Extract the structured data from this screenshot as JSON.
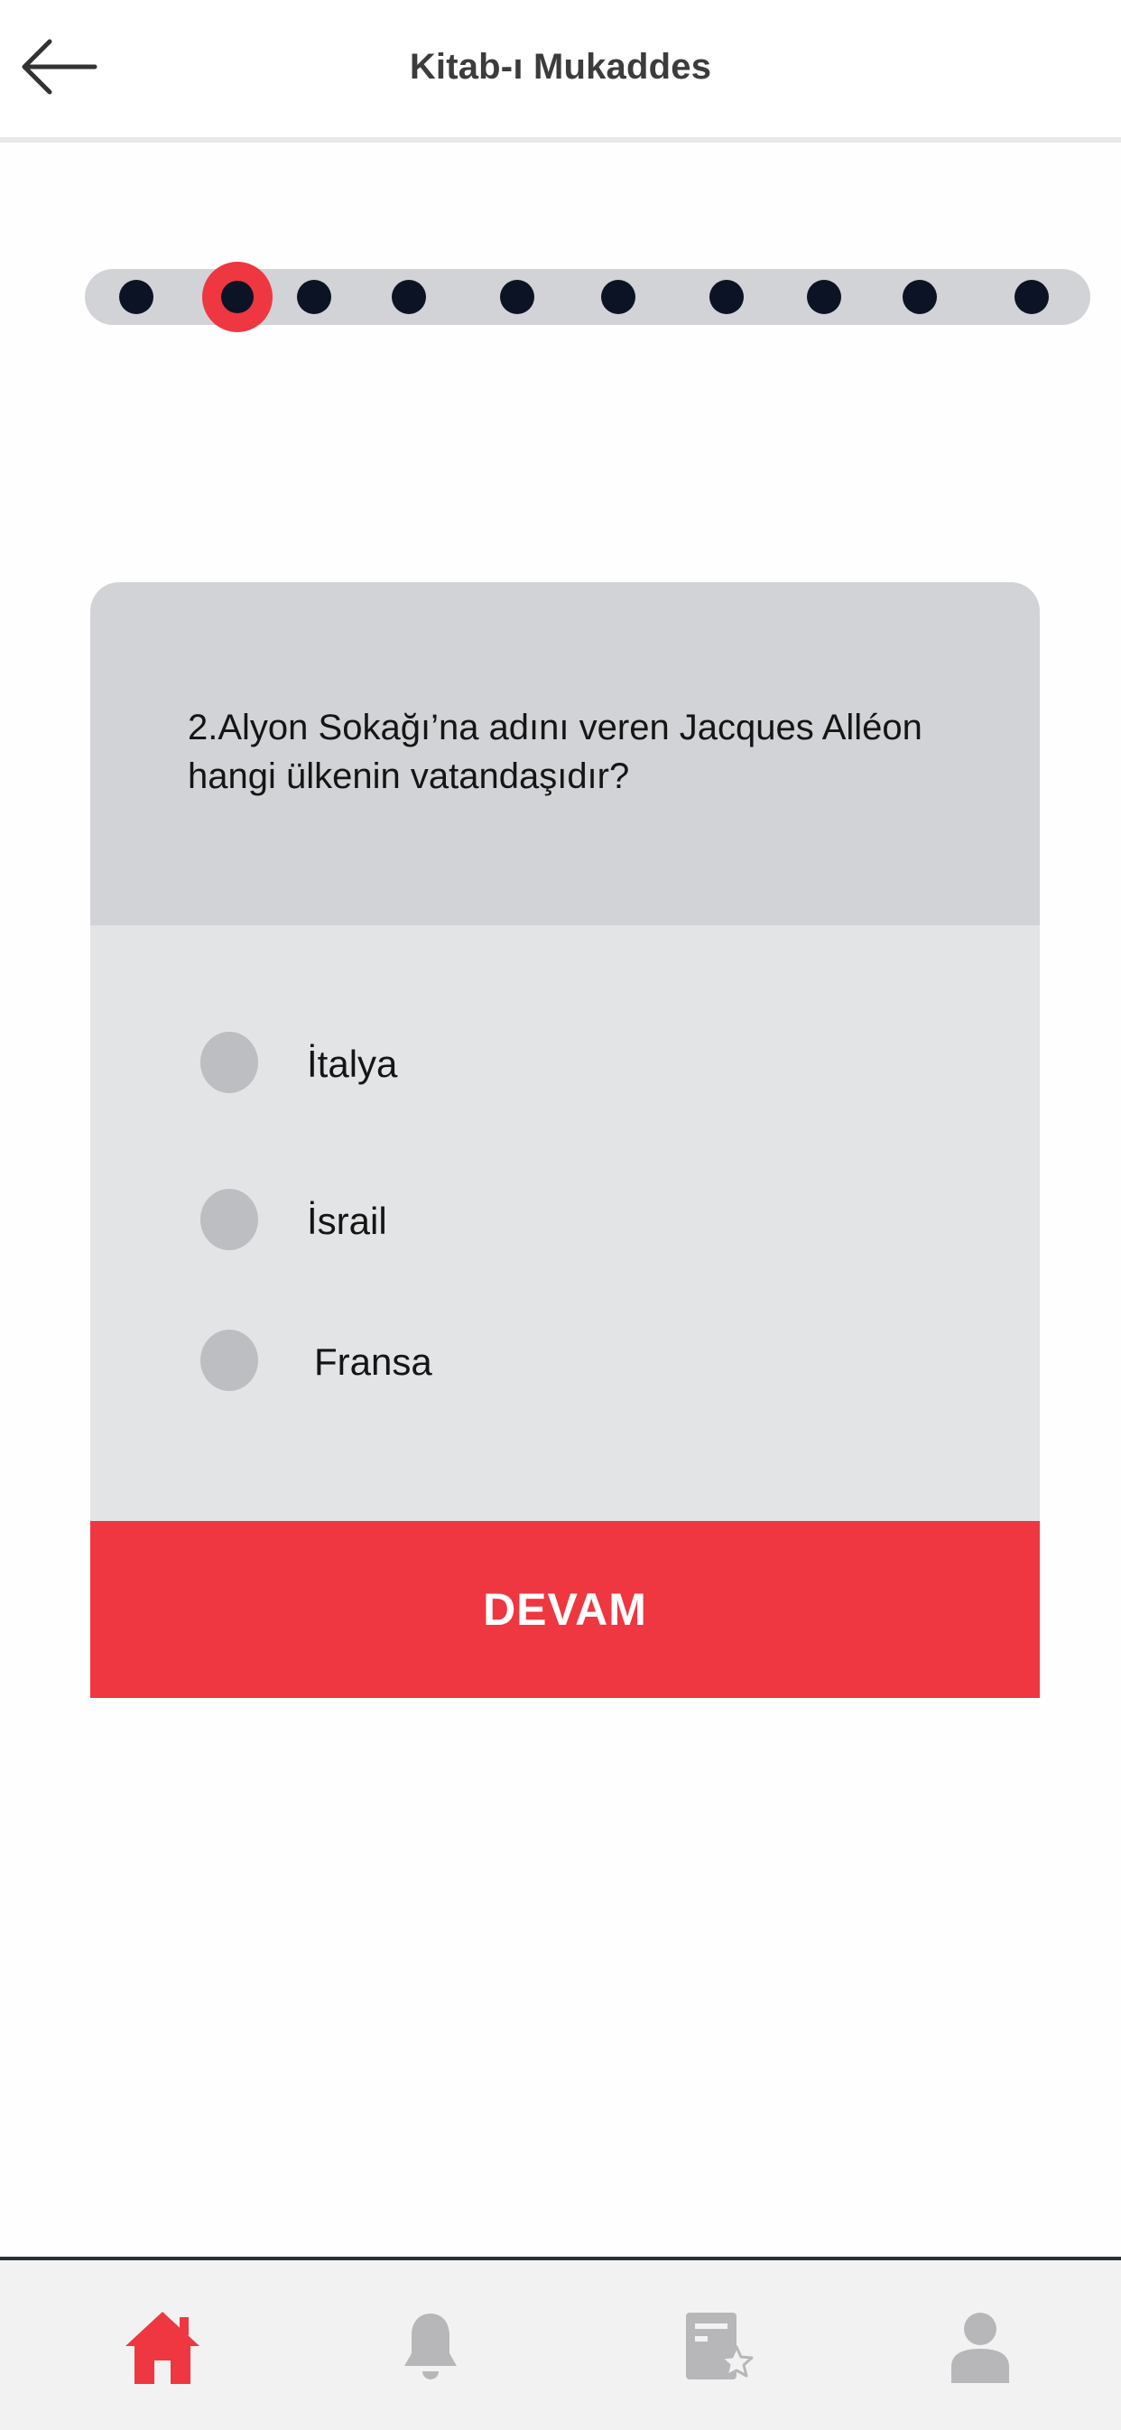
{
  "header": {
    "title": "Kitab-ı Mukaddes",
    "back_icon": "arrow-left-icon"
  },
  "progress": {
    "total_steps": 10,
    "current_step": 2,
    "active_color": "#ee3740",
    "dot_color": "#0c1324"
  },
  "quiz": {
    "question": "2.Alyon Sokağı’na adını veren Jacques Alléon\n hangi ülkenin vatandaşıdır?",
    "options": [
      {
        "label": "İtalya",
        "selected": false
      },
      {
        "label": "İsrail",
        "selected": false
      },
      {
        "label": "Fransa",
        "selected": false
      }
    ],
    "continue_label": "DEVAM"
  },
  "tabbar": {
    "items": [
      {
        "icon": "home-icon",
        "active": true
      },
      {
        "icon": "bell-icon",
        "active": false
      },
      {
        "icon": "favorites-document-icon",
        "active": false
      },
      {
        "icon": "user-icon",
        "active": false
      }
    ],
    "active_color": "#ee3740",
    "inactive_color": "#b7b7b9"
  }
}
